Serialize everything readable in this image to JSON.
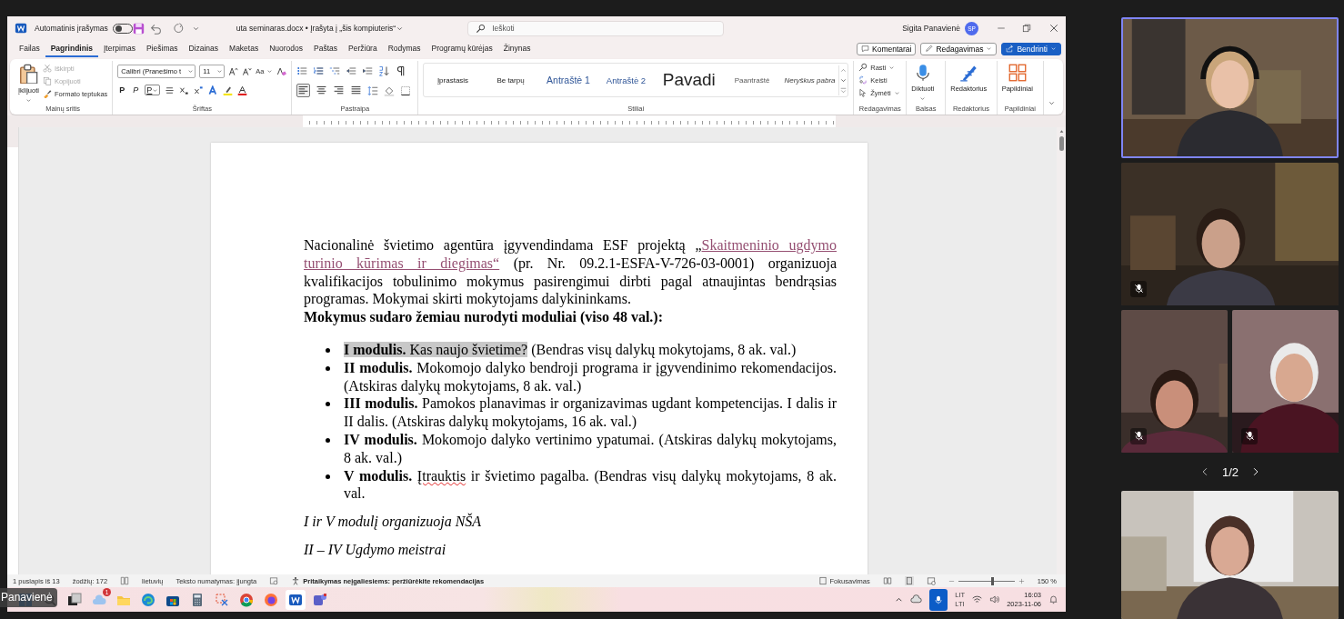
{
  "word": {
    "autosave": {
      "label": "Automatinis įrašymas",
      "on": false
    },
    "file_title": "uta seminaras.docx • Įrašyta į „šis kompiuteris“",
    "search": {
      "placeholder": "Ieškoti"
    },
    "user": {
      "name": "Sigita Panavienė",
      "initials": "SP"
    },
    "tabs": [
      {
        "label": "Failas",
        "selected": false
      },
      {
        "label": "Pagrindinis",
        "selected": true
      },
      {
        "label": "Įterpimas",
        "selected": false
      },
      {
        "label": "Piešimas",
        "selected": false
      },
      {
        "label": "Dizainas",
        "selected": false
      },
      {
        "label": "Maketas",
        "selected": false
      },
      {
        "label": "Nuorodos",
        "selected": false
      },
      {
        "label": "Paštas",
        "selected": false
      },
      {
        "label": "Peržiūra",
        "selected": false
      },
      {
        "label": "Rodymas",
        "selected": false
      },
      {
        "label": "Programų kūrėjas",
        "selected": false
      },
      {
        "label": "Žinynas",
        "selected": false
      }
    ],
    "actions": [
      {
        "label": "Komentarai",
        "kind": "comments"
      },
      {
        "label": "Redagavimas",
        "kind": "editing"
      },
      {
        "label": "Bendrinti",
        "kind": "share"
      }
    ],
    "ribbon": {
      "clipboard": {
        "paste": "Įklijuoti",
        "cut": "Iškirpti",
        "copy": "Kopijuoti",
        "format_painter": "Formato teptukas",
        "label": "Mainų sritis"
      },
      "font": {
        "name": "Calibri (Pranešimo t",
        "size": "11",
        "change_case": "Aa",
        "bold": "P",
        "italic": "P",
        "underline": "P",
        "label": "Šriftas"
      },
      "paragraph": {
        "align_buttons": [
          {
            "kind": "left",
            "selected": true
          },
          {
            "kind": "center",
            "selected": false
          },
          {
            "kind": "right",
            "selected": false
          },
          {
            "kind": "justify",
            "selected": false
          }
        ],
        "label": "Pastraipa"
      },
      "styles": {
        "items": [
          {
            "label": "Įprastasis",
            "kind": "normal"
          },
          {
            "label": "Be tarpų",
            "kind": "normal"
          },
          {
            "label": "Antraštė 1",
            "kind": "heading1"
          },
          {
            "label": "Antraštė 2",
            "kind": "heading2"
          },
          {
            "label": "Pavadi",
            "kind": "title"
          },
          {
            "label": "Paantraštė",
            "kind": "subtitle"
          },
          {
            "label": "Neryškus pabra",
            "kind": "emphasis"
          }
        ],
        "label": "Stiliai"
      },
      "editing": {
        "items": [
          {
            "label": "Rasti",
            "kind": "find"
          },
          {
            "label": "Keisti",
            "kind": "replace"
          },
          {
            "label": "Žymėti",
            "kind": "select"
          }
        ],
        "label": "Redagavimas"
      },
      "tools": [
        {
          "button": "Diktuoti",
          "label": "Balsas",
          "kind": "dictate"
        },
        {
          "button": "Redaktorius",
          "label": "Redaktorius",
          "kind": "editor"
        },
        {
          "button": "Papildiniai",
          "label": "Papildiniai",
          "kind": "addins"
        }
      ]
    },
    "document": {
      "intro": {
        "before": "Nacionalinė švietimo agentūra įgyvendindama ESF projektą „",
        "link_parts": [
          "Skaitmeninio ugdymo",
          "turinio kūrimas ir diegimas“"
        ],
        "after": " (pr. Nr. 09.2.1-ESFA-V-726-03-0001) organizuoja kvalifikacijos tobulinimo mokymus pasirengimui dirbti pagal atnaujintas bendrąsias programas. Mokymai skirti mokytojams dalykininkams."
      },
      "heading": "Mokymus sudaro žemiau nurodyti moduliai (viso 48 val.):",
      "modules": [
        {
          "parts": [
            {
              "text": "**I modulis.** Kas naujo švietime?",
              "selected": true,
              "misspelled": false
            },
            {
              "text": " (Bendras visų dalykų mokytojams, 8 ak. val.)",
              "selected": false,
              "misspelled": false
            }
          ]
        },
        {
          "parts": [
            {
              "text": "**II modulis.** Mokomojo dalyko bendroji programa ir įgyvendinimo rekomendacijos. (Atskiras dalykų mokytojams, 8 ak. val.)",
              "selected": false,
              "misspelled": false
            }
          ]
        },
        {
          "parts": [
            {
              "text": "**III modulis.** Pamokos planavimas ir organizavimas ugdant kompetencijas. I dalis ir II dalis. (Atskiras dalykų mokytojams, 16 ak. val.)",
              "selected": false,
              "misspelled": false
            }
          ]
        },
        {
          "parts": [
            {
              "text": "**IV modulis.** Mokomojo dalyko vertinimo ypatumai. (Atskiras dalykų mokytojams, 8 ak. val.)",
              "selected": false,
              "misspelled": false
            }
          ]
        },
        {
          "parts": [
            {
              "text": "**V modulis.** ",
              "selected": false,
              "misspelled": false
            },
            {
              "text": "Įtrauktis",
              "selected": false,
              "misspelled": true
            },
            {
              "text": " ir švietimo pagalba. (Bendras visų dalykų mokytojams, 8 ak. val.",
              "selected": false,
              "misspelled": false
            }
          ]
        }
      ],
      "notes": [
        "I ir V modulį organizuoja NŠA",
        "II – IV Ugdymo meistrai"
      ]
    },
    "status_bar": {
      "page": "1 puslapis iš 13",
      "words": "žodžių: 172",
      "language": "lietuvių",
      "prediction": "Teksto numatymas: įjungta",
      "accessibility": "Pritaikymas neįgaliesiems: peržiūrėkite rekomendacijas",
      "focus": "Fokusavimas",
      "zoom": {
        "level": 0.6
      },
      "zoom_reading": "150 %"
    }
  },
  "taskbar": {
    "weather_badge": "1",
    "language": [
      "LIT",
      "LTI"
    ],
    "time": "16:03",
    "date": "2023-11-06"
  },
  "presenter_label": "Panavienė",
  "participants": [
    {
      "selected": true,
      "muted": false
    },
    {
      "selected": false,
      "muted": true
    },
    {
      "selected": false,
      "muted": true
    },
    {
      "selected": false,
      "muted": true
    },
    {
      "selected": false,
      "muted": false
    }
  ],
  "pager": "1/2"
}
